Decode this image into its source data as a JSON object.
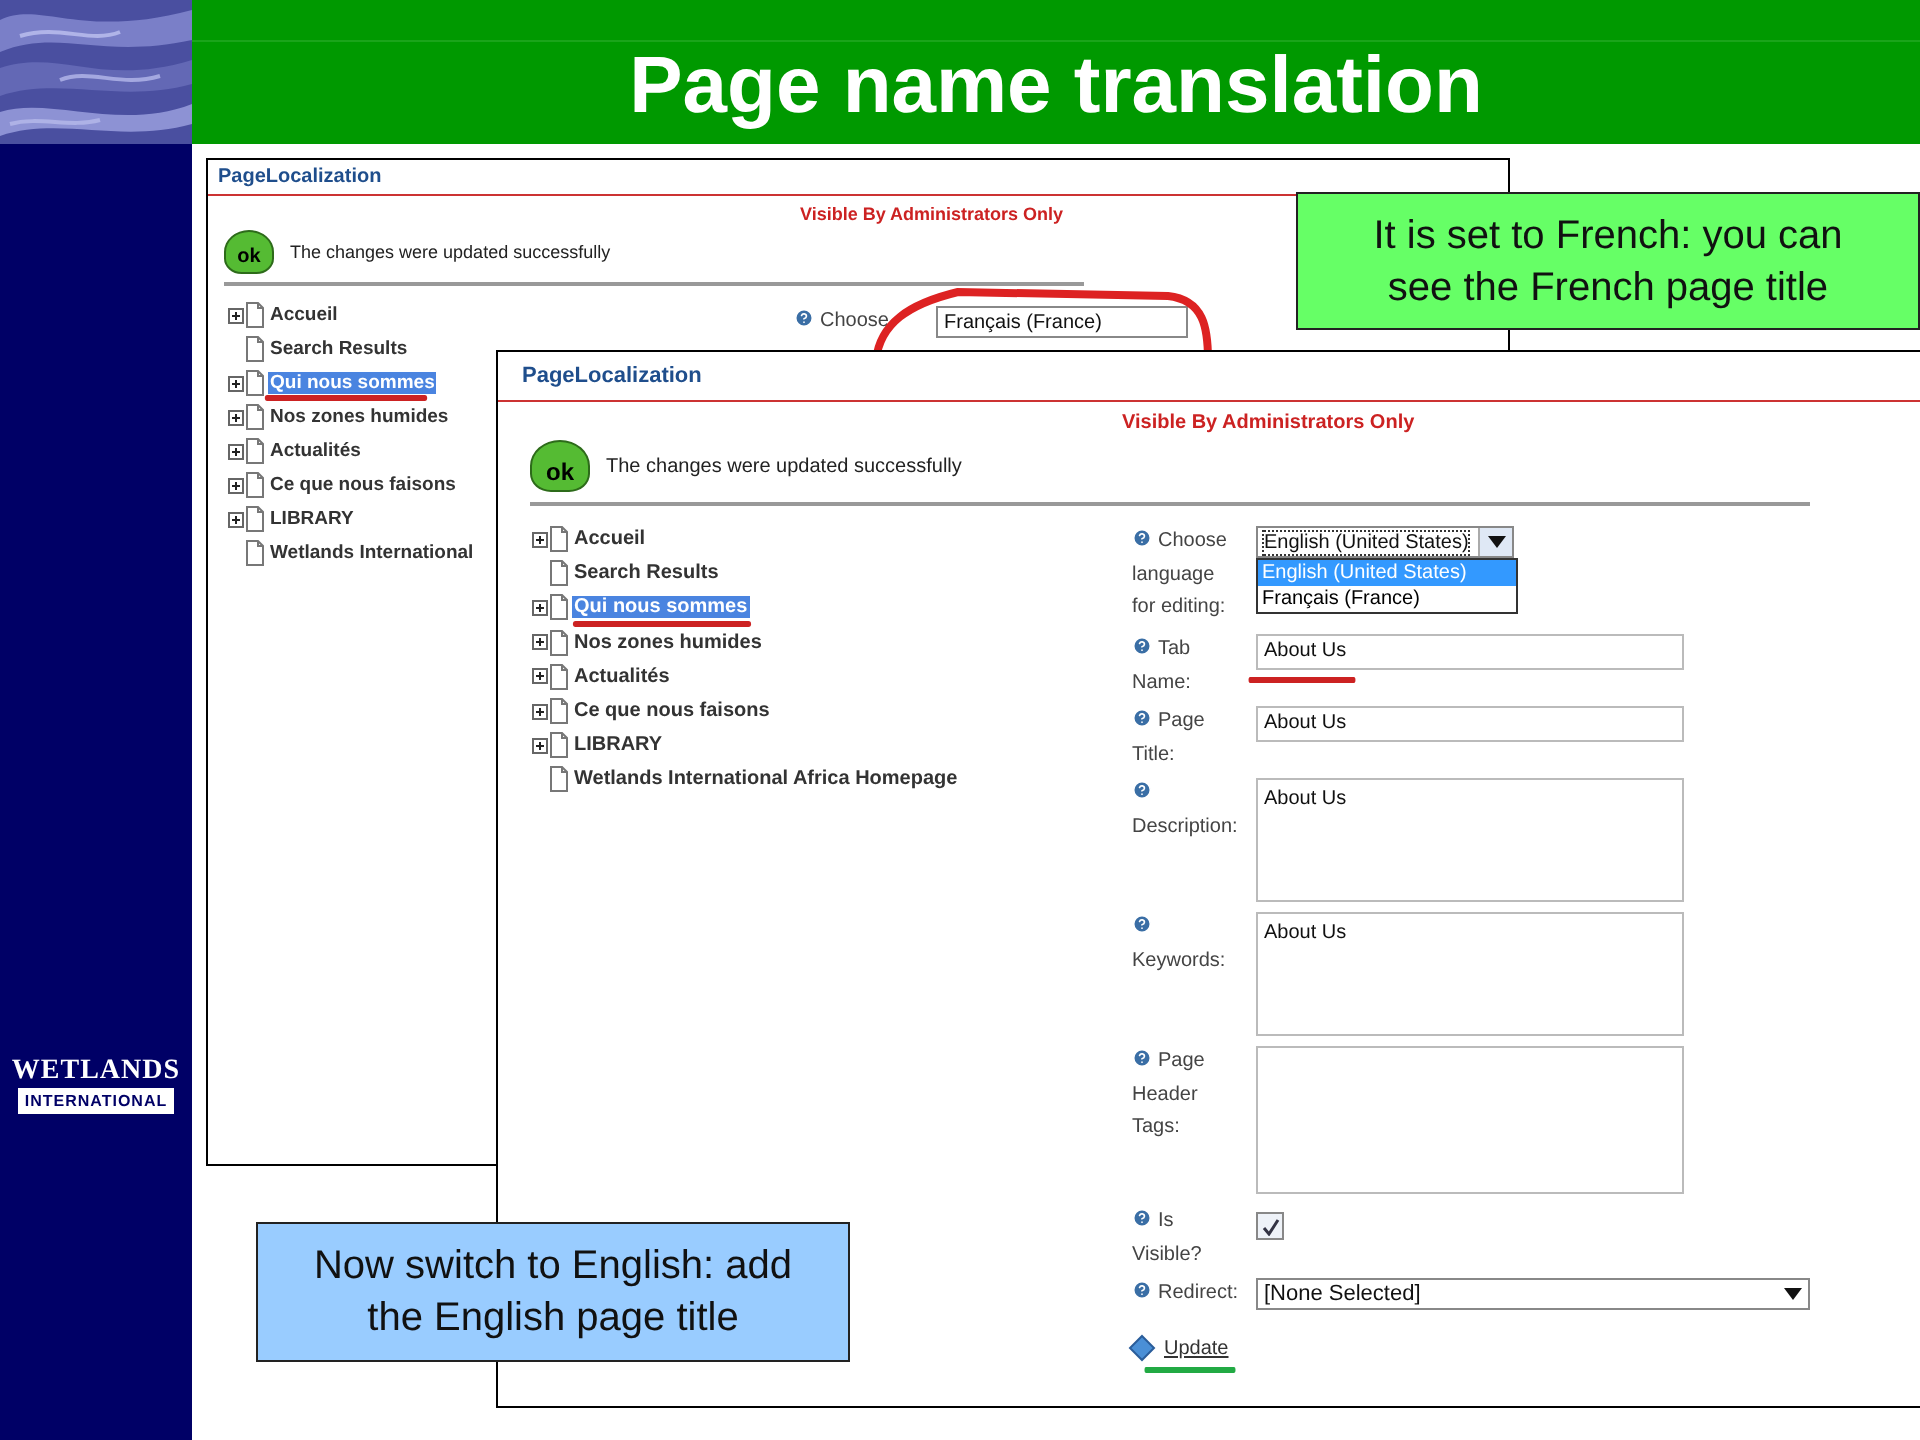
{
  "slide": {
    "title": "Page name translation"
  },
  "logo": {
    "line_1": "WETLANDS",
    "line_2": "INTERNATIONAL"
  },
  "back_screenshot": {
    "title": "PageLocalization",
    "notice": "Visible By Administrators Only",
    "ok_badge": "ok",
    "message": "The changes were updated successfully",
    "tree": [
      {
        "label": "Accueil",
        "expandable": true,
        "selected": false
      },
      {
        "label": "Search Results",
        "expandable": false,
        "selected": false
      },
      {
        "label": "Qui nous sommes",
        "expandable": true,
        "selected": true,
        "marked": true
      },
      {
        "label": "Nos zones humides",
        "expandable": true,
        "selected": false
      },
      {
        "label": "Actualités",
        "expandable": true,
        "selected": false
      },
      {
        "label": "Ce que nous faisons",
        "expandable": true,
        "selected": false
      },
      {
        "label": "LIBRARY",
        "expandable": true,
        "selected": false
      },
      {
        "label": "Wetlands International",
        "expandable": false,
        "selected": false
      }
    ],
    "language_label": "Choose",
    "language_value": "Français (France)",
    "language_circled": true
  },
  "front_screenshot": {
    "title": "PageLocalization",
    "notice": "Visible By Administrators Only",
    "ok_badge": "ok",
    "message": "The changes were updated successfully",
    "tree": [
      {
        "label": "Accueil",
        "expandable": true,
        "selected": false
      },
      {
        "label": "Search Results",
        "expandable": false,
        "selected": false
      },
      {
        "label": "Qui nous sommes",
        "expandable": true,
        "selected": true,
        "marked": true
      },
      {
        "label": "Nos zones humides",
        "expandable": true,
        "selected": false
      },
      {
        "label": "Actualités",
        "expandable": true,
        "selected": false
      },
      {
        "label": "Ce que nous faisons",
        "expandable": true,
        "selected": false
      },
      {
        "label": "LIBRARY",
        "expandable": true,
        "selected": false
      },
      {
        "label": "Wetlands International Africa Homepage",
        "expandable": false,
        "selected": false
      }
    ],
    "fields": [
      {
        "kind": "dropdown",
        "label": "Choose language for editing:",
        "value": "English (United States)",
        "expanded": true,
        "options": [
          {
            "label": "English (United States)",
            "selected": true
          },
          {
            "label": "Français (France)",
            "selected": false
          }
        ]
      },
      {
        "kind": "text",
        "label": "Tab Name:",
        "value": "About Us",
        "marked": true
      },
      {
        "kind": "text",
        "label": "Page Title:",
        "value": "About Us"
      },
      {
        "kind": "textarea",
        "label": "Description:",
        "value": "About Us"
      },
      {
        "kind": "textarea",
        "label": "Keywords:",
        "value": "About Us"
      },
      {
        "kind": "textarea",
        "label": "Page Header Tags:"
      },
      {
        "kind": "checkbox",
        "label": "Is Visible?",
        "checked": true
      },
      {
        "kind": "select",
        "label": "Redirect:",
        "value": "[None Selected]"
      }
    ],
    "update_link": {
      "label": "Update",
      "marked": true
    }
  },
  "callouts": [
    {
      "text": "It is set to French: you can see the French page title",
      "color": "#66ff66"
    },
    {
      "text": "Now switch to English: add the English page title",
      "color": "#99ccff"
    }
  ]
}
